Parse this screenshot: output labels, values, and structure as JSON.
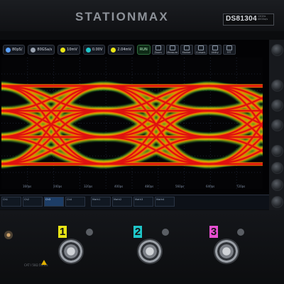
{
  "header": {
    "brand": "STATIONMAX",
    "model": "DS81304",
    "model_spec_lines": [
      "13GHz",
      "40GSa/s"
    ]
  },
  "toolbar": {
    "items": [
      {
        "label": "80pS/",
        "icon": "timebase-icon"
      },
      {
        "label": "80GSa/s",
        "icon": "sample-rate-icon"
      },
      {
        "label": "10mV",
        "icon": "channel-scale-icon"
      },
      {
        "label": "0.00V",
        "icon": "offset-icon"
      },
      {
        "label": "2.04mV",
        "icon": "trigger-icon"
      }
    ],
    "run_label": "RUN",
    "buttons": [
      "Zoom",
      "Measure",
      "Marker",
      "Cursors",
      "Utility",
      "FFT"
    ]
  },
  "plot": {
    "x_ticks": [
      "160ps",
      "240ps",
      "320ps",
      "400ps",
      "480ps",
      "560ps",
      "640ps",
      "720ps"
    ],
    "right_ticks": [
      "",
      "",
      "",
      "",
      "",
      "",
      "",
      "",
      "",
      ""
    ]
  },
  "statusbar": {
    "cells": [
      {
        "title": "Ch1",
        "line1": "",
        "line2": ""
      },
      {
        "title": "Ch2",
        "line1": "",
        "line2": ""
      },
      {
        "title": "Ch3",
        "line1": "",
        "line2": ""
      },
      {
        "title": "Ch4",
        "line1": "",
        "line2": ""
      },
      {
        "title": "Math1",
        "line1": "",
        "line2": ""
      },
      {
        "title": "Math2",
        "line1": "",
        "line2": ""
      },
      {
        "title": "Math3",
        "line1": "",
        "line2": ""
      },
      {
        "title": "Math4",
        "line1": "",
        "line2": ""
      }
    ],
    "time": "",
    "date": ""
  },
  "inputs": {
    "channels": [
      "1",
      "2",
      "3"
    ],
    "colors": {
      "ch1": "#e9e516",
      "ch2": "#1fc6c9",
      "ch3": "#e64fd1"
    },
    "bottom_label": "CAT I 50Ω 5Vrms"
  },
  "chart_data": {
    "type": "heatmap",
    "title": "",
    "xlabel": "",
    "ylabel": "",
    "x_ticks": [
      "160ps",
      "240ps",
      "320ps",
      "400ps",
      "480ps",
      "560ps",
      "640ps",
      "720ps"
    ],
    "levels": 4,
    "note": ""
  }
}
